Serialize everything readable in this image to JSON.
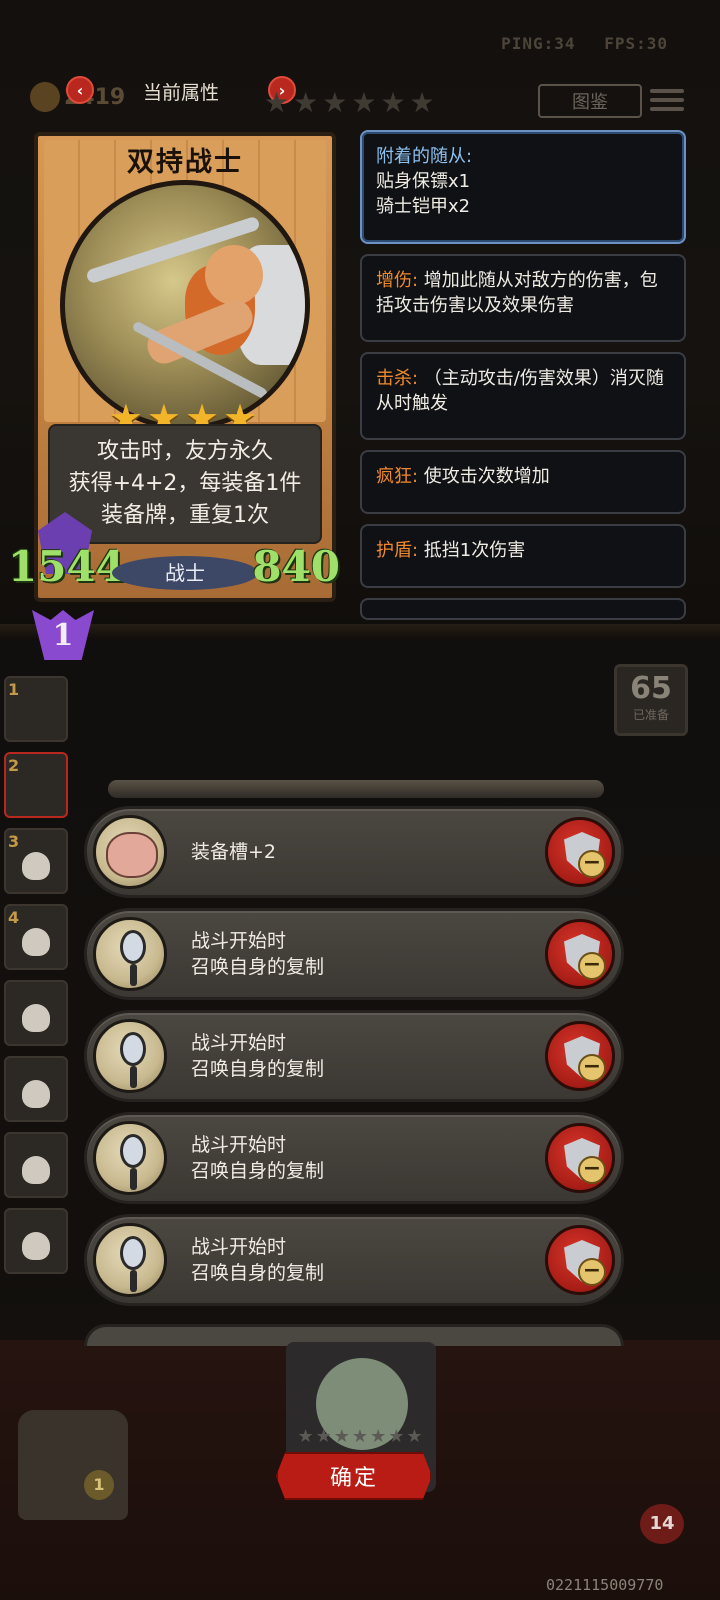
{
  "status": {
    "ping": "PING:34",
    "fps": "FPS:30"
  },
  "gold": "2419",
  "codex_label": "图鉴",
  "header": {
    "title": "当前属性",
    "prev": "‹",
    "next": "›"
  },
  "hero": {
    "name": "双持战士",
    "stars": "★★★★",
    "desc_lines": [
      "攻击时，友方永久",
      "获得+4+2，每装备1件",
      "装备牌，重复1次"
    ],
    "attack": "1544",
    "health": "840",
    "class": "战士",
    "level": "1"
  },
  "keywords": [
    {
      "key": "附着的随从:",
      "lines": [
        "贴身保镖x1",
        "骑士铠甲x2"
      ]
    },
    {
      "key": "增伤:",
      "text": " 增加此随从对敌方的伤害，包括攻击伤害以及效果伤害"
    },
    {
      "key": "击杀:",
      "text": " （主动攻击/伤害效果）消灭随从时触发"
    },
    {
      "key": "疯狂:",
      "text": " 使攻击次数增加"
    },
    {
      "key": "护盾:",
      "text": " 抵挡1次伤害"
    }
  ],
  "side_slots": [
    "1",
    "2",
    "3",
    "4"
  ],
  "ready": {
    "count": "65",
    "label": "已准备"
  },
  "equipment": [
    {
      "line1": "装备槽+2",
      "line2": ""
    },
    {
      "line1": "战斗开始时",
      "line2": "召唤自身的复制"
    },
    {
      "line1": "战斗开始时",
      "line2": "召唤自身的复制"
    },
    {
      "line1": "战斗开始时",
      "line2": "召唤自身的复制"
    },
    {
      "line1": "战斗开始时",
      "line2": "召唤自身的复制"
    }
  ],
  "confirm_label": "确定",
  "bottom_stars": "★★★★★★★",
  "chest_count": "1",
  "lives": "14",
  "footer_id": "0221115009770",
  "colors": {
    "accent_red": "#b81c14",
    "keyword_orange": "#f08a2c",
    "stat_green": "#9ee06a",
    "panel_blue": "#6c92c4"
  },
  "icons": [
    "coin-icon",
    "codex-icon",
    "menu-icon",
    "mirror-icon",
    "pig-icon",
    "shield-remove-icon",
    "skull-icon"
  ]
}
